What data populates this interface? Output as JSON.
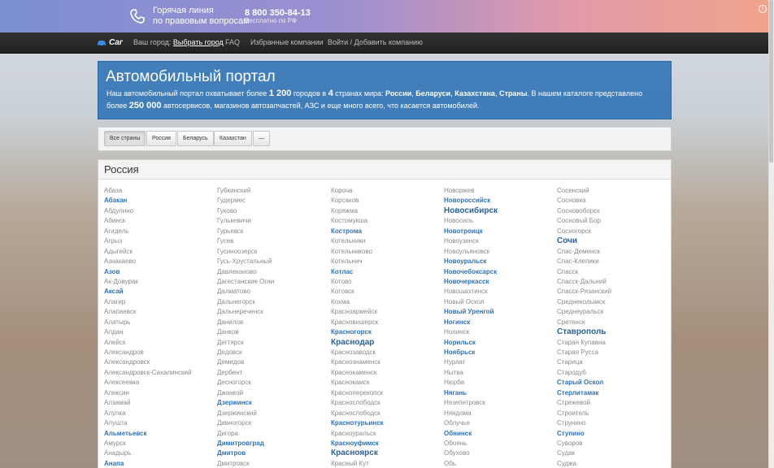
{
  "hotline": {
    "line1": "Горячая линия",
    "line2": "по правовым вопросам",
    "phone": "8 800 350-84-13",
    "free": "Бесплатно по РФ"
  },
  "nav": {
    "brand": "Car",
    "city_label": "Ваш город:",
    "city_link": "Выбрать город",
    "faq": "FAQ",
    "favorites": "Избранные компании",
    "login": "Войти / Добавить компанию"
  },
  "hero": {
    "title": "Автомобильный портал",
    "t1": "Наш автомобильный портал охватывает более ",
    "cities_count": "1 200",
    "t2": " городов в ",
    "countries_count": "4",
    "t3": " странах мира: ",
    "country1": "России",
    "country2": "Беларуси",
    "country3": "Казахстана",
    "country4": "Страны",
    "t4": ". В нашем каталоге представлено более ",
    "services_count": "250 000",
    "t5": " автосервисов, магазинов автозапчастей, АЗС и еще много всего, что касается автомобилей."
  },
  "filters": [
    "Все страны",
    "Россия",
    "Беларусь",
    "Казахстан",
    "—"
  ],
  "panel": {
    "title": "Россия"
  },
  "columns": [
    [
      {
        "n": "Абаза",
        "w": 0
      },
      {
        "n": "Абакан",
        "w": 1
      },
      {
        "n": "Абдулино",
        "w": 0
      },
      {
        "n": "Абинск",
        "w": 0
      },
      {
        "n": "Агидель",
        "w": 0
      },
      {
        "n": "Агрыз",
        "w": 0
      },
      {
        "n": "Адыгейск",
        "w": 0
      },
      {
        "n": "Азнакаево",
        "w": 0
      },
      {
        "n": "Азов",
        "w": 1
      },
      {
        "n": "Ак-Довурак",
        "w": 0
      },
      {
        "n": "Аксай",
        "w": 1
      },
      {
        "n": "Алагир",
        "w": 0
      },
      {
        "n": "Алапаевск",
        "w": 0
      },
      {
        "n": "Алатырь",
        "w": 0
      },
      {
        "n": "Алдан",
        "w": 0
      },
      {
        "n": "Алейск",
        "w": 0
      },
      {
        "n": "Александров",
        "w": 0
      },
      {
        "n": "Александровск",
        "w": 0
      },
      {
        "n": "Александровск-Сахалинский",
        "w": 0
      },
      {
        "n": "Алексеевка",
        "w": 0
      },
      {
        "n": "Алексин",
        "w": 0
      },
      {
        "n": "Алзамай",
        "w": 0
      },
      {
        "n": "Алупка",
        "w": 0
      },
      {
        "n": "Алушта",
        "w": 0
      },
      {
        "n": "Альметьевск",
        "w": 1
      },
      {
        "n": "Амурск",
        "w": 0
      },
      {
        "n": "Анадырь",
        "w": 0
      },
      {
        "n": "Анапа",
        "w": 1
      }
    ],
    [
      {
        "n": "Губкинский",
        "w": 0
      },
      {
        "n": "Гудермес",
        "w": 0
      },
      {
        "n": "Гуково",
        "w": 0
      },
      {
        "n": "Гулькевичи",
        "w": 0
      },
      {
        "n": "Гурьевск",
        "w": 0
      },
      {
        "n": "Гусев",
        "w": 0
      },
      {
        "n": "Гусиноозерск",
        "w": 0
      },
      {
        "n": "Гусь-Хрустальный",
        "w": 0
      },
      {
        "n": "Давлеканово",
        "w": 0
      },
      {
        "n": "Дагестанские Огни",
        "w": 0
      },
      {
        "n": "Далматово",
        "w": 0
      },
      {
        "n": "Дальнегорск",
        "w": 0
      },
      {
        "n": "Дальнереченск",
        "w": 0
      },
      {
        "n": "Данилов",
        "w": 0
      },
      {
        "n": "Данков",
        "w": 0
      },
      {
        "n": "Дегтярск",
        "w": 0
      },
      {
        "n": "Дедовск",
        "w": 0
      },
      {
        "n": "Демидов",
        "w": 0
      },
      {
        "n": "Дербент",
        "w": 0
      },
      {
        "n": "Десногорск",
        "w": 0
      },
      {
        "n": "Джанкой",
        "w": 0
      },
      {
        "n": "Дзержинск",
        "w": 1
      },
      {
        "n": "Дзержинский",
        "w": 0
      },
      {
        "n": "Дивногорск",
        "w": 0
      },
      {
        "n": "Дигора",
        "w": 0
      },
      {
        "n": "Димитровград",
        "w": 1
      },
      {
        "n": "Дмитров",
        "w": 1
      },
      {
        "n": "Дмитровск",
        "w": 0
      }
    ],
    [
      {
        "n": "Короча",
        "w": 0
      },
      {
        "n": "Корсаков",
        "w": 0
      },
      {
        "n": "Коряжма",
        "w": 0
      },
      {
        "n": "Костомукша",
        "w": 0
      },
      {
        "n": "Кострома",
        "w": 1
      },
      {
        "n": "Котельники",
        "w": 0
      },
      {
        "n": "Котельниково",
        "w": 0
      },
      {
        "n": "Котельнич",
        "w": 0
      },
      {
        "n": "Котлас",
        "w": 1
      },
      {
        "n": "Котово",
        "w": 0
      },
      {
        "n": "Котовск",
        "w": 0
      },
      {
        "n": "Кохма",
        "w": 0
      },
      {
        "n": "Красноармейск",
        "w": 0
      },
      {
        "n": "Красновишерск",
        "w": 0
      },
      {
        "n": "Красногорск",
        "w": 1
      },
      {
        "n": "Краснодар",
        "w": 2
      },
      {
        "n": "Краснозаводск",
        "w": 0
      },
      {
        "n": "Краснознаменск",
        "w": 0
      },
      {
        "n": "Краснокаменск",
        "w": 0
      },
      {
        "n": "Краснокамск",
        "w": 0
      },
      {
        "n": "Красноперекопск",
        "w": 0
      },
      {
        "n": "Краснослободск",
        "w": 0
      },
      {
        "n": "Краснослободск",
        "w": 0
      },
      {
        "n": "Краснотурьинск",
        "w": 1
      },
      {
        "n": "Красноуральск",
        "w": 0
      },
      {
        "n": "Красноуфимск",
        "w": 1
      },
      {
        "n": "Красноярск",
        "w": 2
      },
      {
        "n": "Красный Кут",
        "w": 0
      }
    ],
    [
      {
        "n": "Новоржев",
        "w": 0
      },
      {
        "n": "Новороссийск",
        "w": 1
      },
      {
        "n": "Новосибирск",
        "w": 2
      },
      {
        "n": "Новосиль",
        "w": 0
      },
      {
        "n": "Новотроицк",
        "w": 1
      },
      {
        "n": "Новоузенск",
        "w": 0
      },
      {
        "n": "Новоульяновск",
        "w": 0
      },
      {
        "n": "Новоуральск",
        "w": 1
      },
      {
        "n": "Новочебоксарск",
        "w": 1
      },
      {
        "n": "Новочеркасск",
        "w": 1
      },
      {
        "n": "Новошахтинск",
        "w": 0
      },
      {
        "n": "Новый Оскол",
        "w": 0
      },
      {
        "n": "Новый Уренгой",
        "w": 1
      },
      {
        "n": "Ногинск",
        "w": 1
      },
      {
        "n": "Нолинск",
        "w": 0
      },
      {
        "n": "Норильск",
        "w": 1
      },
      {
        "n": "Ноябрьск",
        "w": 1
      },
      {
        "n": "Нурлат",
        "w": 0
      },
      {
        "n": "Нытва",
        "w": 0
      },
      {
        "n": "Нюрба",
        "w": 0
      },
      {
        "n": "Нягань",
        "w": 1
      },
      {
        "n": "Нязепетровск",
        "w": 0
      },
      {
        "n": "Няндома",
        "w": 0
      },
      {
        "n": "Облучье",
        "w": 0
      },
      {
        "n": "Обнинск",
        "w": 1
      },
      {
        "n": "Обоянь",
        "w": 0
      },
      {
        "n": "Обухово",
        "w": 0
      },
      {
        "n": "Обь",
        "w": 0
      }
    ],
    [
      {
        "n": "Сосенский",
        "w": 0
      },
      {
        "n": "Сосновка",
        "w": 0
      },
      {
        "n": "Сосновоборск",
        "w": 0
      },
      {
        "n": "Сосновый Бор",
        "w": 0
      },
      {
        "n": "Сосногорск",
        "w": 0
      },
      {
        "n": "Сочи",
        "w": 2
      },
      {
        "n": "Спас-Деменск",
        "w": 0
      },
      {
        "n": "Спас-Клепики",
        "w": 0
      },
      {
        "n": "Спасск",
        "w": 0
      },
      {
        "n": "Спасск-Дальний",
        "w": 0
      },
      {
        "n": "Спасск-Рязанский",
        "w": 0
      },
      {
        "n": "Среднеколымск",
        "w": 0
      },
      {
        "n": "Среднеуральск",
        "w": 0
      },
      {
        "n": "Сретенск",
        "w": 0
      },
      {
        "n": "Ставрополь",
        "w": 2
      },
      {
        "n": "Старая Купавна",
        "w": 0
      },
      {
        "n": "Старая Русса",
        "w": 0
      },
      {
        "n": "Старица",
        "w": 0
      },
      {
        "n": "Стародуб",
        "w": 0
      },
      {
        "n": "Старый Оскол",
        "w": 1
      },
      {
        "n": "Стерлитамак",
        "w": 1
      },
      {
        "n": "Стрежевой",
        "w": 0
      },
      {
        "n": "Строитель",
        "w": 0
      },
      {
        "n": "Струнино",
        "w": 0
      },
      {
        "n": "Ступино",
        "w": 1
      },
      {
        "n": "Суворов",
        "w": 0
      },
      {
        "n": "Судак",
        "w": 0
      },
      {
        "n": "Суджа",
        "w": 0
      }
    ]
  ]
}
